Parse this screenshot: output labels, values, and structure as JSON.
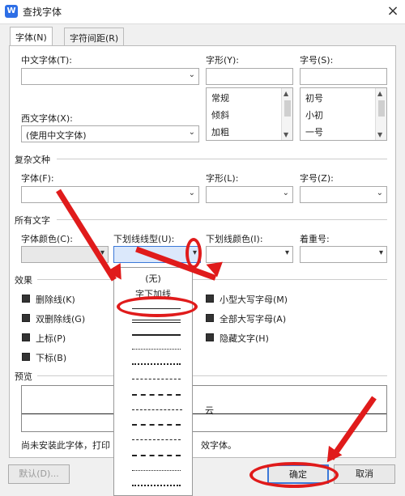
{
  "window": {
    "title": "查找字体",
    "close_icon": "×"
  },
  "tabs": [
    {
      "label": "字体(N)"
    },
    {
      "label": "字符间距(R)"
    }
  ],
  "fields": {
    "chinese_font_label": "中文字体(T):",
    "western_font_label": "西文字体(X):",
    "western_font_value": "(使用中文字体)",
    "style_label": "字形(Y):",
    "size_label": "字号(S):",
    "style_options": [
      "常规",
      "倾斜",
      "加粗"
    ],
    "size_options": [
      "初号",
      "小初",
      "一号"
    ]
  },
  "complex": {
    "section_label": "复杂文种",
    "font_label": "字体(F):",
    "style_label": "字形(L):",
    "size_label": "字号(Z):"
  },
  "all_text": {
    "section_label": "所有文字",
    "font_color_label": "字体颜色(C):",
    "underline_type_label": "下划线线型(U):",
    "underline_color_label": "下划线颜色(I):",
    "emphasis_label": "着重号:"
  },
  "effects": {
    "section_label": "效果",
    "items": [
      {
        "label": "删除线(K)"
      },
      {
        "label": "双删除线(G)"
      },
      {
        "label": "上标(P)"
      },
      {
        "label": "下标(B)"
      },
      {
        "label": "小型大写字母(M)"
      },
      {
        "label": "全部大写字母(A)"
      },
      {
        "label": "隐藏文字(H)"
      }
    ]
  },
  "underline_dropdown": {
    "none": "(无)",
    "word_only": "字下加线"
  },
  "preview": {
    "section_label": "预览",
    "sample_text": "云",
    "note_left": "尚未安装此字体，打印",
    "note_right": "效字体。"
  },
  "buttons": {
    "default": "默认(D)...",
    "ok": "确定",
    "cancel": "取消"
  },
  "colors": {
    "annotation": "#e01b1b",
    "accent": "#3b78d8"
  }
}
